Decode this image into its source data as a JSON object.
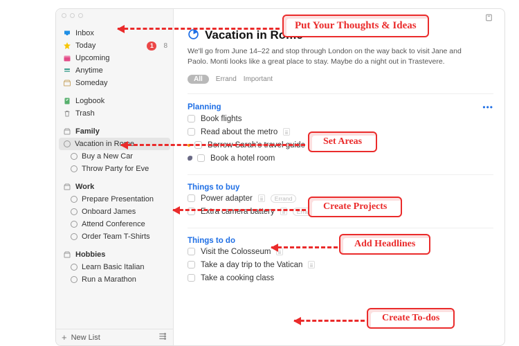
{
  "sidebar": {
    "core": [
      {
        "icon": "inbox-icon",
        "color": "#1f8fe5",
        "label": "Inbox",
        "badge": null,
        "count": null
      },
      {
        "icon": "star-icon",
        "color": "#f7c500",
        "label": "Today",
        "badge": "1",
        "count": "8"
      },
      {
        "icon": "calendar-icon",
        "color": "#e24a87",
        "label": "Upcoming",
        "badge": null,
        "count": null
      },
      {
        "icon": "stack-icon",
        "color": "#3a9e8d",
        "label": "Anytime",
        "badge": null,
        "count": null
      },
      {
        "icon": "box-icon",
        "color": "#c9a86a",
        "label": "Someday",
        "badge": null,
        "count": null
      }
    ],
    "archive": [
      {
        "icon": "logbook-icon",
        "color": "#57b06d",
        "label": "Logbook"
      },
      {
        "icon": "trash-icon",
        "color": "#9a9a9a",
        "label": "Trash"
      }
    ],
    "areas": [
      {
        "name": "Family",
        "projects": [
          {
            "label": "Vacation in Rome",
            "selected": true
          },
          {
            "label": "Buy a New Car",
            "selected": false
          },
          {
            "label": "Throw Party for Eve",
            "selected": false
          }
        ]
      },
      {
        "name": "Work",
        "projects": [
          {
            "label": "Prepare Presentation",
            "selected": false
          },
          {
            "label": "Onboard James",
            "selected": false
          },
          {
            "label": "Attend Conference",
            "selected": false
          },
          {
            "label": "Order Team T-Shirts",
            "selected": false
          }
        ]
      },
      {
        "name": "Hobbies",
        "projects": [
          {
            "label": "Learn Basic Italian",
            "selected": false
          },
          {
            "label": "Run a Marathon",
            "selected": false
          }
        ]
      }
    ],
    "footer": {
      "new_list": "New List"
    }
  },
  "project": {
    "title": "Vacation in Rome",
    "notes": "We'll go from June 14–22 and stop through London on the way back to visit Jane and Paolo. Monti looks like a great place to stay. Maybe do a night out in Trastevere.",
    "tag_all": "All",
    "tag_errand": "Errand",
    "tag_important": "Important",
    "sections": [
      {
        "title": "Planning",
        "tasks": [
          {
            "text": "Book flights",
            "note": false,
            "tag": null,
            "flag": false,
            "evening": false,
            "struck": false
          },
          {
            "text": "Read about the metro",
            "note": true,
            "tag": null,
            "flag": false,
            "evening": false,
            "struck": false
          },
          {
            "text": "Borrow Sarah's travel guide",
            "note": false,
            "tag": null,
            "flag": true,
            "evening": false,
            "struck": true
          },
          {
            "text": "Book a hotel room",
            "note": false,
            "tag": null,
            "flag": false,
            "evening": true,
            "struck": false
          }
        ]
      },
      {
        "title": "Things to buy",
        "tasks": [
          {
            "text": "Power adapter",
            "note": true,
            "tag": "Errand",
            "flag": false,
            "evening": false,
            "struck": false
          },
          {
            "text": "Extra camera battery",
            "note": true,
            "tag": "Errand",
            "flag": false,
            "evening": false,
            "struck": false
          }
        ]
      },
      {
        "title": "Things to do",
        "tasks": [
          {
            "text": "Visit the Colosseum",
            "note": true,
            "tag": null,
            "flag": false,
            "evening": false,
            "struck": false
          },
          {
            "text": "Take a day trip to the Vatican",
            "note": true,
            "tag": null,
            "flag": false,
            "evening": false,
            "struck": false
          },
          {
            "text": "Take a cooking class",
            "note": false,
            "tag": null,
            "flag": false,
            "evening": false,
            "struck": false
          }
        ]
      }
    ]
  },
  "callouts": {
    "thoughts": "Put Your Thoughts & Ideas",
    "areas": "Set Areas",
    "projects": "Create Projects",
    "headlines": "Add Headlines",
    "todos": "Create To-dos"
  }
}
